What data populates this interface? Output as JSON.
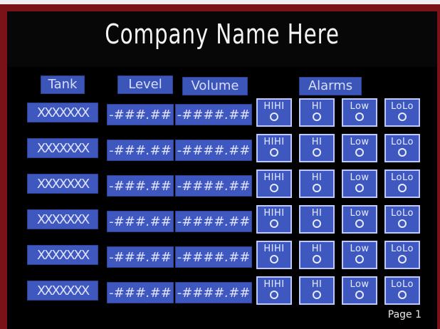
{
  "header": {
    "title": "Company Name Here"
  },
  "columns": {
    "tank": "Tank",
    "level": "Level",
    "volume": "Volume",
    "alarms": "Alarms"
  },
  "rows": [
    {
      "tank": "XXXXXXX",
      "level": "-###.##",
      "volume": "-####.##"
    },
    {
      "tank": "XXXXXXX",
      "level": "-###.##",
      "volume": "-####.##"
    },
    {
      "tank": "XXXXXXX",
      "level": "-###.##",
      "volume": "-####.##"
    },
    {
      "tank": "XXXXXXX",
      "level": "-###.##",
      "volume": "-####.##"
    },
    {
      "tank": "XXXXXXX",
      "level": "-###.##",
      "volume": "-####.##"
    },
    {
      "tank": "XXXXXXX",
      "level": "-###.##",
      "volume": "-####.##"
    }
  ],
  "alarm_labels": [
    "HIHI",
    "HI",
    "Low",
    "LoLo"
  ],
  "footer": {
    "page": "Page  1"
  },
  "colors": {
    "panel_bg": "#000000",
    "frame": "#7a1218",
    "field_blue": "#3f58c0",
    "text_light": "#dfe3ff"
  }
}
